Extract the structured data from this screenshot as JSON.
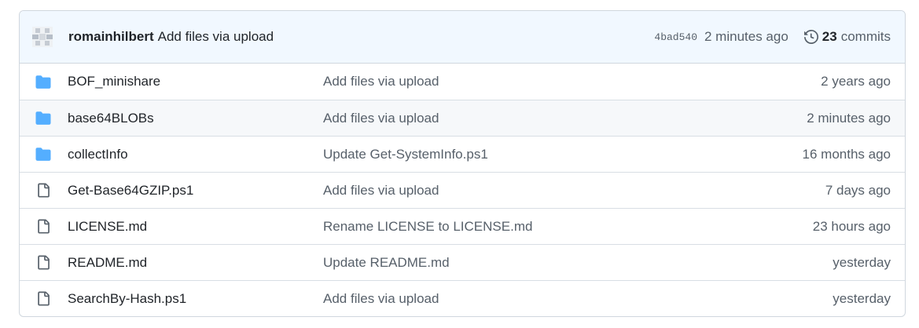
{
  "header": {
    "author": "romainhilbert",
    "commit_message": "Add files via upload",
    "sha": "4bad540",
    "age": "2 minutes ago",
    "commits_count": "23",
    "commits_label": "commits"
  },
  "colors": {
    "folder": "#54aeff",
    "file": "#57606a",
    "header_bg": "#f1f8ff"
  },
  "files": [
    {
      "type": "folder-icon",
      "name": "BOF_minishare",
      "message": "Add files via upload",
      "time": "2 years ago"
    },
    {
      "type": "folder-icon",
      "name": "base64BLOBs",
      "message": "Add files via upload",
      "time": "2 minutes ago"
    },
    {
      "type": "folder-icon",
      "name": "collectInfo",
      "message": "Update Get-SystemInfo.ps1",
      "time": "16 months ago"
    },
    {
      "type": "file-icon",
      "name": "Get-Base64GZIP.ps1",
      "message": "Add files via upload",
      "time": "7 days ago"
    },
    {
      "type": "file-icon",
      "name": "LICENSE.md",
      "message": "Rename LICENSE to LICENSE.md",
      "time": "23 hours ago"
    },
    {
      "type": "file-icon",
      "name": "README.md",
      "message": "Update README.md",
      "time": "yesterday"
    },
    {
      "type": "file-icon",
      "name": "SearchBy-Hash.ps1",
      "message": "Add files via upload",
      "time": "yesterday"
    }
  ]
}
